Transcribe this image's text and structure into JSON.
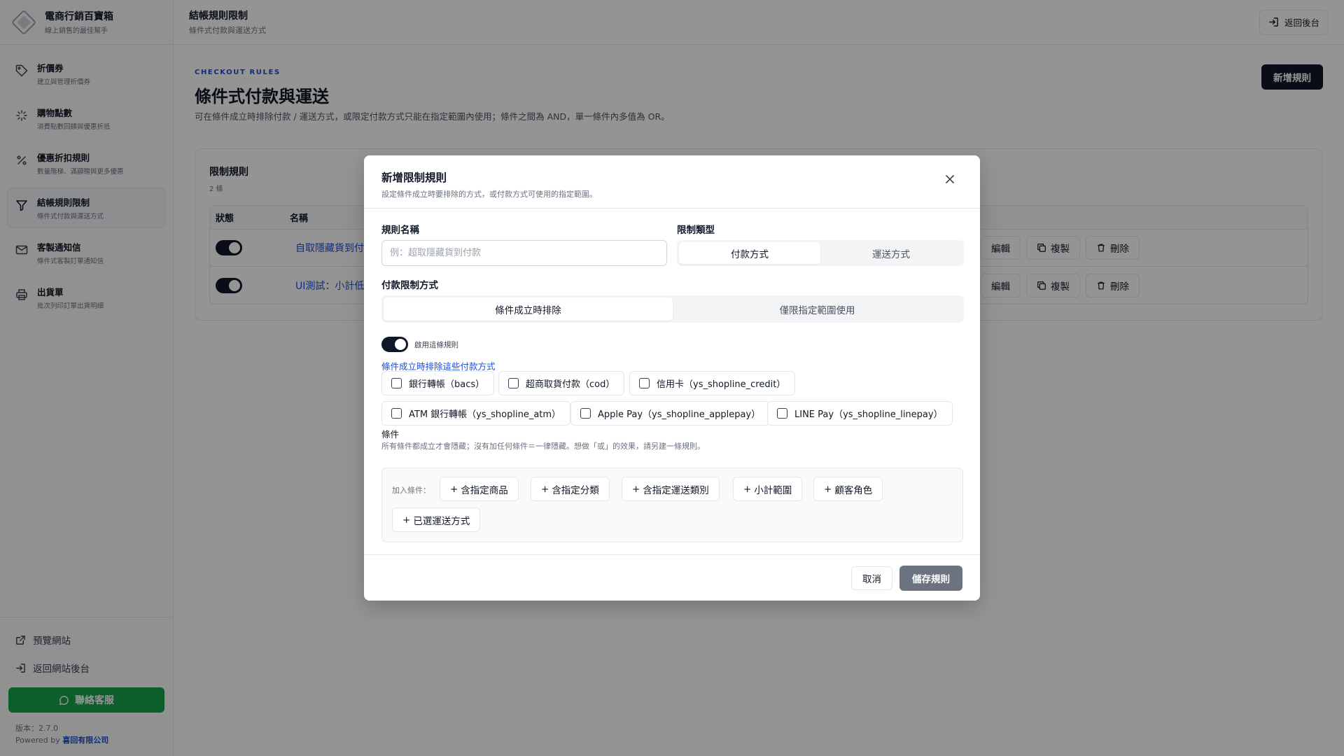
{
  "brand": {
    "title": "電商行銷百寶箱",
    "subtitle": "線上銷售的最佳幫手"
  },
  "sidebar": {
    "items": [
      {
        "label": "折價券",
        "desc": "建立與管理折價券",
        "icon": "tag-icon"
      },
      {
        "label": "購物點數",
        "desc": "消費點數回饋與優惠折抵",
        "icon": "sparkle-icon"
      },
      {
        "label": "優惠折扣規則",
        "desc": "數量階梯、滿額贈與更多優惠",
        "icon": "percent-icon"
      },
      {
        "label": "結帳規則限制",
        "desc": "條件式付款與運送方式",
        "icon": "filter-icon",
        "active": true
      },
      {
        "label": "客製通知信",
        "desc": "條件式客製訂單通知信",
        "icon": "mail-icon"
      },
      {
        "label": "出貨單",
        "desc": "批次列印訂單出貨明細",
        "icon": "printer-icon"
      }
    ],
    "preview_label": "預覽網站",
    "back_label": "返回網站後台",
    "support_label": "聯絡客服",
    "version_text": "版本：2.7.0",
    "powered_by": "Powered by",
    "company": "喜回有限公司",
    "support_color": "#16a34a"
  },
  "topbar": {
    "title": "結帳規則限制",
    "subtitle": "條件式付款與運送方式",
    "back_label": "返回後台"
  },
  "page": {
    "eyebrow": "CHECKOUT RULES",
    "title": "條件式付款與運送",
    "description": "可在條件成立時排除付款 / 運送方式，或限定付款方式只能在指定範圍內使用；條件之間為 AND，單一條件內多值為 OR。",
    "new_rule_label": "新增規則"
  },
  "rules_card": {
    "title": "限制規則",
    "count": "2 條",
    "columns": {
      "status": "狀態",
      "name": "名稱"
    },
    "rows": [
      {
        "name": "自取隱藏貨到付款",
        "enabled": true
      },
      {
        "name": "UI測試：小計低於",
        "enabled": true
      }
    ],
    "edit_label": "編輯",
    "copy_label": "複製",
    "delete_label": "刪除"
  },
  "modal": {
    "title": "新增限制規則",
    "subtitle": "設定條件成立時要排除的方式，或付款方式可使用的指定範圍。",
    "rule_name_label": "規則名稱",
    "rule_name_placeholder": "例：超取隱藏貨到付款",
    "rule_name_value": "",
    "restriction_type_label": "限制類型",
    "restriction_types": [
      "付款方式",
      "運送方式"
    ],
    "payment_mode_label": "付款限制方式",
    "payment_modes": [
      "條件成立時排除",
      "僅限指定範圍使用"
    ],
    "enable_label": "啟用這條規則",
    "enabled": true,
    "exclude_label": "條件成立時排除這些付款方式",
    "payment_methods": [
      "銀行轉帳（bacs）",
      "超商取貨付款（cod）",
      "信用卡（ys_shopline_credit）",
      "ATM 銀行轉帳（ys_shopline_atm）",
      "Apple Pay（ys_shopline_applepay）",
      "LINE Pay（ys_shopline_linepay）"
    ],
    "conditions_title": "條件",
    "conditions_desc": "所有條件都成立才會隱藏；沒有加任何條件＝一律隱藏。想做「或」的效果，請另建一條規則。",
    "add_condition_label": "加入條件：",
    "condition_buttons": [
      "含指定商品",
      "含指定分類",
      "含指定運送類別",
      "小計範圍",
      "顧客角色",
      "已選運送方式"
    ],
    "cancel_label": "取消",
    "save_label": "儲存規則"
  }
}
